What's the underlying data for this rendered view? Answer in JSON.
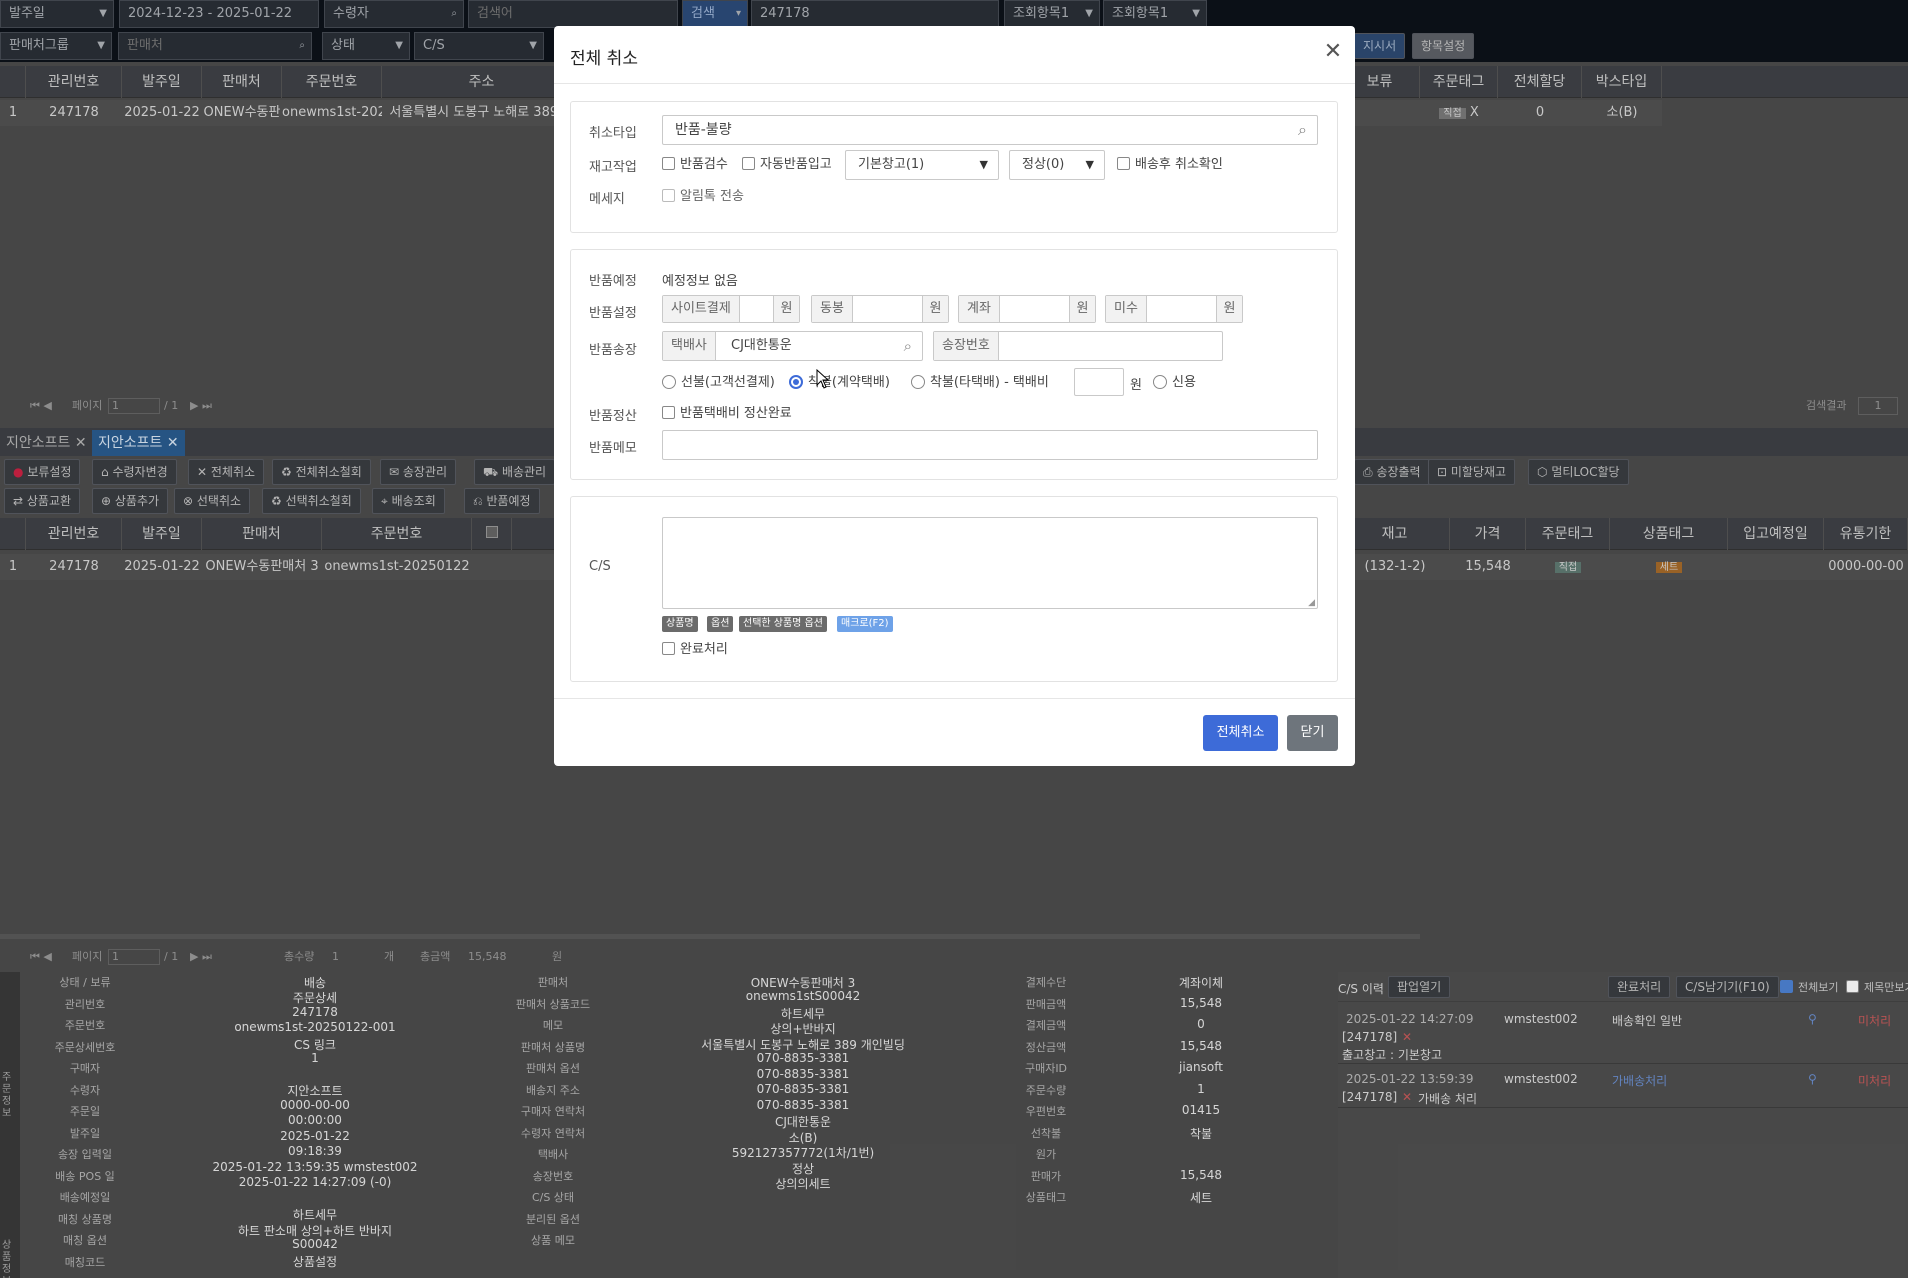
{
  "topbar": {
    "row1": [
      {
        "value": "발주일",
        "dropdown": true
      },
      {
        "value": "2024-12-23 - 2025-01-22"
      },
      {
        "value": "수령자",
        "icon": "search-icon"
      },
      {
        "placeholder": "검색어"
      },
      {
        "value": "검색"
      },
      {
        "value": "247178"
      },
      {
        "value": "조회항목1",
        "dropdown": true
      },
      {
        "value": "조회항목1",
        "dropdown": true
      }
    ],
    "row2": [
      {
        "value": "판매처그룹",
        "dropdown": true
      },
      {
        "placeholder": "판매처"
      },
      {
        "value": "상태",
        "dropdown": true
      },
      {
        "value": "C/S",
        "dropdown": true
      }
    ],
    "right_buttons": [
      "지시서",
      "항목설정"
    ]
  },
  "grid1": {
    "headers": [
      "관리번호",
      "발주일",
      "판매처",
      "주문번호",
      "주소",
      "보류",
      "주문태그",
      "전체할당",
      "박스타입"
    ],
    "row": [
      "1",
      "247178",
      "2025-01-22",
      "ONEW수동판",
      "onewms1st-2025(",
      "서울특별시 도봉구 노해로 389 ...",
      "직접",
      "X",
      "0",
      "소(B)"
    ]
  },
  "pager1": {
    "label": "페이지",
    "value": "1",
    "total": "/ 1",
    "result_label": "검색결과",
    "result_value": "1"
  },
  "tabs": [
    "지안소프트",
    "지안소프트"
  ],
  "toolbar1": [
    "보류설정",
    "수령자변경",
    "전체취소",
    "전체취소철회",
    "송장관리",
    "배송관리",
    "송장출력",
    "미할당재고",
    "멀티LOC할당"
  ],
  "toolbar2": [
    "상품교환",
    "상품추가",
    "선택취소",
    "선택취소철회",
    "배송조회",
    "반품예정"
  ],
  "grid2": {
    "headers": [
      "관리번호",
      "발주일",
      "판매처",
      "주문번호",
      "재고",
      "가격",
      "주문태그",
      "상품태그",
      "입고예정일",
      "유통기한"
    ],
    "row": [
      "1",
      "247178",
      "2025-01-22",
      "ONEW수동판매처 3",
      "onewms1st-20250122",
      "(132-1-2)",
      "15,548",
      "직접",
      "세트",
      "0000-00-00"
    ]
  },
  "pager2": {
    "label": "페이지",
    "value": "1",
    "total": "/ 1",
    "qty_label": "총수량",
    "qty_value": "1",
    "qty_unit": "개",
    "amount_label": "총금액",
    "amount_value": "15,548",
    "amount_unit": "원"
  },
  "detail": {
    "labels_left": [
      "상태 / 보류",
      "관리번호",
      "주문번호",
      "주문상세번호",
      "구매자",
      "수령자",
      "주문일",
      "발주일",
      "송장 입력일",
      "배송 POS 일",
      "배송예정일",
      "매칭 상품명",
      "매칭 옵션",
      "매칭코드"
    ],
    "values_left": [
      "배송",
      "주문상세",
      "247178",
      "onewms1st-20250122-001",
      "CS 링크",
      "1",
      "",
      "지안소프트",
      "0000-00-00",
      "00:00:00",
      "2025-01-22",
      "09:18:39",
      "2025-01-22 13:59:35 wmstest002",
      "2025-01-22 14:27:09 (-0)",
      "",
      "하트세무",
      "하트 판소매 상의+하트 반바지",
      "S00042",
      "상품설정"
    ],
    "labels_mid": [
      "판매처",
      "판매처 상품코드",
      "메모",
      "판매처 상품명",
      "판매처 옵션",
      "배송지 주소",
      "구매자 연락처",
      "수령자 연락처",
      "택배사",
      "송장번호",
      "C/S 상태",
      "분리된 옵션",
      "상품 메모"
    ],
    "values_mid": [
      "ONEW수동판매처 3",
      "onewms1stS00042",
      "하트세무",
      "상의+반바지",
      "서울특별시 도봉구 노해로 389 개인빌딩",
      "070-8835-3381",
      "070-8835-3381",
      "070-8835-3381",
      "070-8835-3381",
      "CJ대한통운",
      "소(B)",
      "592127357772(1차/1번)",
      "정상",
      "상의의세트"
    ],
    "labels_right": [
      "결제수단",
      "판매금액",
      "결제금액",
      "정산금액",
      "구매자ID",
      "주문수량",
      "우편번호",
      "선착불",
      "원가",
      "판매가",
      "상품태그"
    ],
    "values_right": [
      "계좌이체",
      "15,548",
      "0",
      "15,548",
      "jiansoft",
      "1",
      "01415",
      "착불",
      "",
      "15,548",
      "세트"
    ],
    "side_labels": [
      "주문정보",
      "상품정보"
    ]
  },
  "cs_history": {
    "title": "C/S 이력",
    "buttons": [
      "팝업열기",
      "완료처리",
      "C/S남기기(F10)"
    ],
    "checks": [
      "전체보기",
      "제목만보기"
    ],
    "entries": [
      {
        "date": "2025-01-22 14:27:09",
        "user": "wmstest002",
        "type": "배송확인 일반",
        "status": "미처리",
        "ref": "[247178]",
        "text": "출고창고 : 기본창고"
      },
      {
        "date": "2025-01-22 13:59:39",
        "user": "wmstest002",
        "type": "가배송처리",
        "status": "미처리",
        "ref": "[247178]",
        "text": "가배송 처리"
      }
    ]
  },
  "modal": {
    "title": "전체 취소",
    "cancel_type_label": "취소타입",
    "cancel_type_value": "반품-불량",
    "stock_label": "재고작업",
    "stock_checks": [
      "반품검수",
      "자동반품입고"
    ],
    "warehouse_select": "기본창고(1)",
    "normal_select": "정상(0)",
    "after_ship_check": "배송후 취소확인",
    "message_label": "메세지",
    "alimtalk_check": "알림톡 전송",
    "return_plan_label": "반품예정",
    "return_plan_value": "예정정보 없음",
    "return_setting_label": "반품설정",
    "return_setting_groups": [
      {
        "prefix": "사이트결제",
        "suffix": "원"
      },
      {
        "prefix": "동봉",
        "suffix": "원"
      },
      {
        "prefix": "계좌",
        "suffix": "원"
      },
      {
        "prefix": "미수",
        "suffix": "원"
      }
    ],
    "return_invoice_label": "반품송장",
    "courier_prefix": "택배사",
    "courier_value": "CJ대한통운",
    "invoice_prefix": "송장번호",
    "radios": [
      "선불(고객선결제)",
      "착불(계약택배)",
      "착불(타택배) - 택배비",
      "신용"
    ],
    "radio_selected": 1,
    "fee_unit": "원",
    "return_settle_label": "반품정산",
    "return_settle_check": "반품택배비 정산완료",
    "return_memo_label": "반품메모",
    "cs_label": "C/S",
    "macro_tags": [
      "상품명",
      "옵션",
      "선택한 상품명 옵션",
      "매크로(F2)"
    ],
    "complete_check": "완료처리",
    "primary_button": "전체취소",
    "close_button": "닫기"
  }
}
